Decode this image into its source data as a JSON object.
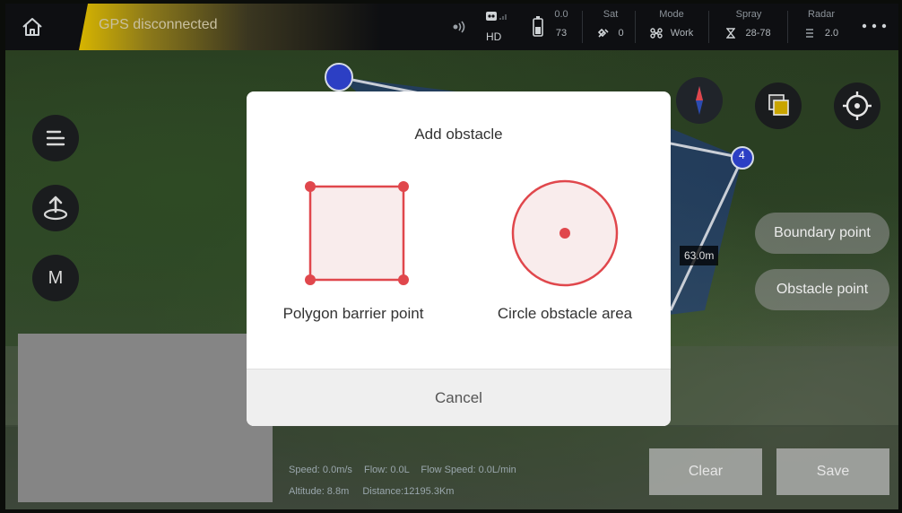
{
  "status_bar": {
    "gps_text": "GPS disconnected",
    "signal": {
      "top": "",
      "bottom": "HD"
    },
    "battery": {
      "top": "0.0",
      "bottom": "73"
    },
    "sat": {
      "label": "Sat",
      "value": "0"
    },
    "mode": {
      "label": "Mode",
      "value": "Work"
    },
    "spray": {
      "label": "Spray",
      "value": "28-78"
    },
    "radar": {
      "label": "Radar",
      "value": "2.0"
    }
  },
  "map": {
    "waypoint_4_label": "4",
    "distance_label": "63.0m",
    "side_buttons": {
      "menu": "menu",
      "takeoff": "takeoff",
      "mode_label": "M"
    }
  },
  "right_panel": {
    "boundary_point": "Boundary point",
    "obstacle_point": "Obstacle point"
  },
  "telemetry": {
    "speed": "Speed: 0.0m/s",
    "flow": "Flow: 0.0L",
    "flow_speed": "Flow Speed: 0.0L/min",
    "altitude": "Altitude: 8.8m",
    "distance": "Distance:12195.3Km"
  },
  "actions": {
    "clear": "Clear",
    "save": "Save"
  },
  "dialog": {
    "title": "Add obstacle",
    "polygon_label": "Polygon barrier point",
    "circle_label": "Circle obstacle area",
    "cancel": "Cancel"
  },
  "colors": {
    "accent_red": "#e0474c",
    "gps_bar": "#d7b500",
    "waypoint_blue": "#2c3fc4"
  }
}
